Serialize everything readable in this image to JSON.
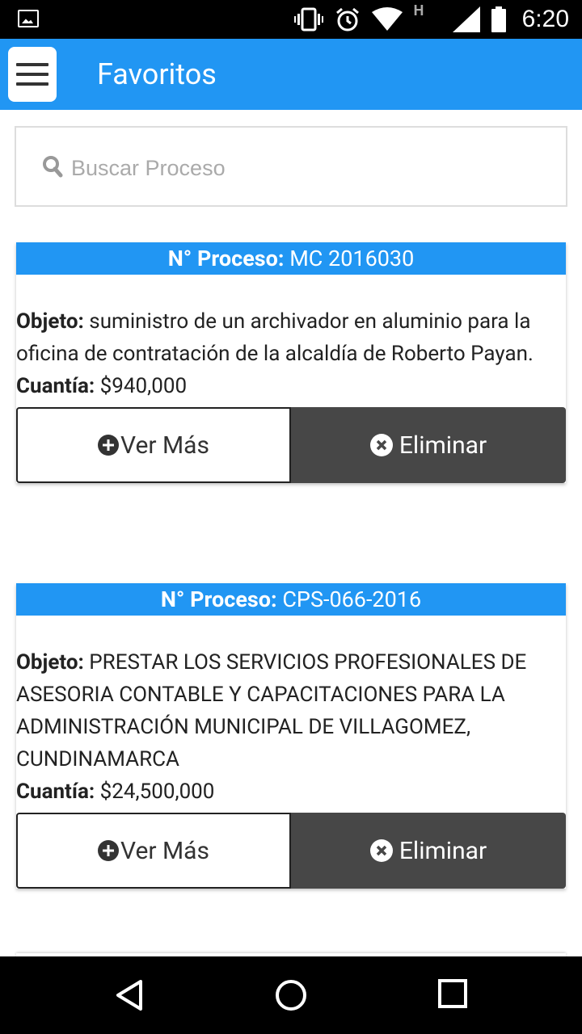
{
  "status_bar": {
    "time": "6:20",
    "icons": [
      "image-icon",
      "vibrate-icon",
      "alarm-icon",
      "wifi-icon",
      "h-network-icon",
      "signal-icon",
      "battery-icon"
    ],
    "network_label": "H"
  },
  "app_bar": {
    "title": "Favoritos",
    "menu_icon": "hamburger-menu-icon",
    "color": "#2196f3"
  },
  "search": {
    "placeholder": "Buscar Proceso",
    "value": "",
    "icon": "search-icon"
  },
  "cards": [
    {
      "process_label": "N° Proceso:",
      "process_value": "MC 2016030",
      "object_label": "Objeto:",
      "object_value": "suministro de un archivador en aluminio para la oficina de contratación de la alcaldía de Roberto Payan.",
      "amount_label": "Cuantía:",
      "amount_value": "$940,000",
      "more_label": "Ver Más",
      "delete_label": "Eliminar"
    },
    {
      "process_label": "N° Proceso:",
      "process_value": "CPS-066-2016",
      "object_label": "Objeto:",
      "object_value": "PRESTAR LOS SERVICIOS PROFESIONALES DE ASESORIA CONTABLE Y CAPACITACIONES PARA LA ADMINISTRACIÓN MUNICIPAL DE VILLAGOMEZ, CUNDINAMARCA",
      "amount_label": "Cuantía:",
      "amount_value": "$24,500,000",
      "more_label": "Ver Más",
      "delete_label": "Eliminar"
    }
  ],
  "nav_bar": {
    "icons": [
      "back-icon",
      "home-icon",
      "recents-icon"
    ]
  }
}
